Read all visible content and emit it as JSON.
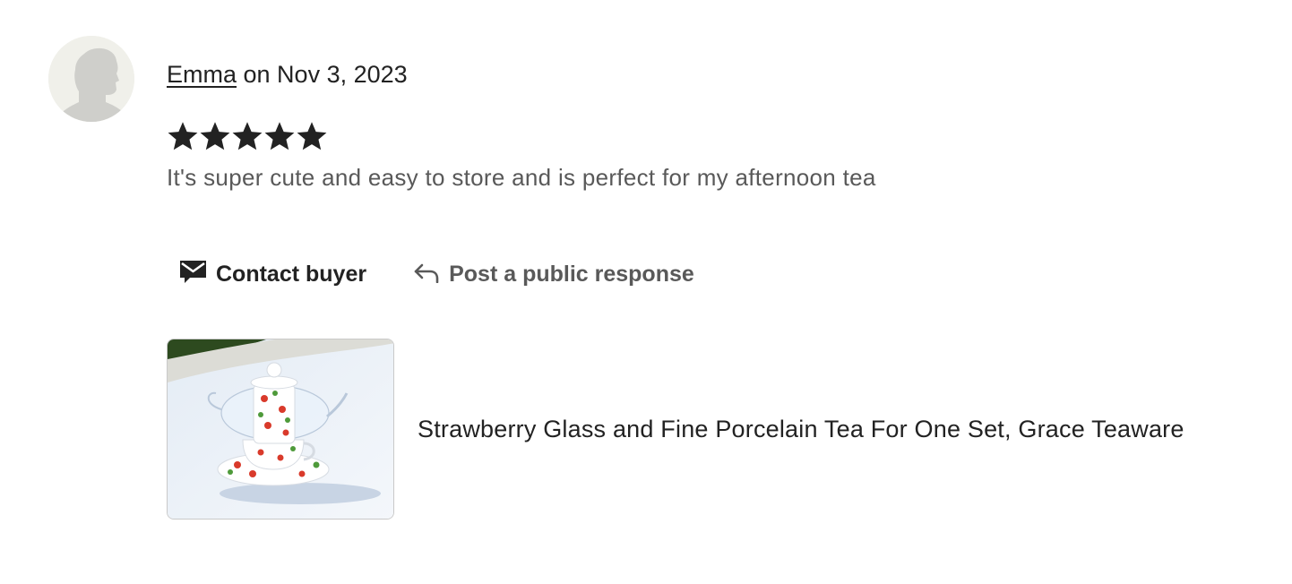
{
  "review": {
    "reviewer_name": "Emma",
    "date_text": " on Nov 3, 2023",
    "rating": 5,
    "rating_max": 5,
    "text": "It's super cute and easy to store and is perfect for my afternoon tea"
  },
  "actions": {
    "contact_label": "Contact buyer",
    "respond_label": "Post a public response"
  },
  "listing": {
    "title": "Strawberry Glass and Fine Porcelain Tea For One Set, Grace Teaware"
  },
  "icons": {
    "avatar": "user-silhouette-icon",
    "star": "star-icon",
    "contact": "envelope-icon",
    "respond": "reply-arrow-icon"
  },
  "colors": {
    "text_primary": "#222222",
    "text_secondary": "#595959",
    "star": "#222222",
    "avatar_bg": "#f0f0ea",
    "avatar_fg": "#cfcfcb"
  }
}
